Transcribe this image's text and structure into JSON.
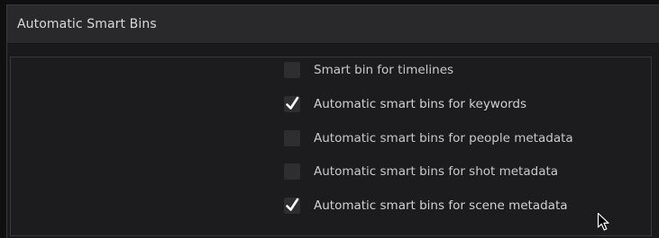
{
  "panel": {
    "title": "Automatic Smart Bins"
  },
  "options": [
    {
      "label": "Smart bin for timelines",
      "checked": false
    },
    {
      "label": "Automatic smart bins for keywords",
      "checked": true
    },
    {
      "label": "Automatic smart bins for people metadata",
      "checked": false
    },
    {
      "label": "Automatic smart bins for shot metadata",
      "checked": false
    },
    {
      "label": "Automatic smart bins for scene metadata",
      "checked": true
    }
  ],
  "colors": {
    "panel_bg": "#1b1b1d",
    "header_bg": "#29292c",
    "checkbox_bg": "#2e2e31",
    "text": "#c9c9c9",
    "checkmark": "#ffffff"
  },
  "icons": {
    "checkmark": "checkmark-icon",
    "cursor": "mouse-pointer-icon"
  }
}
